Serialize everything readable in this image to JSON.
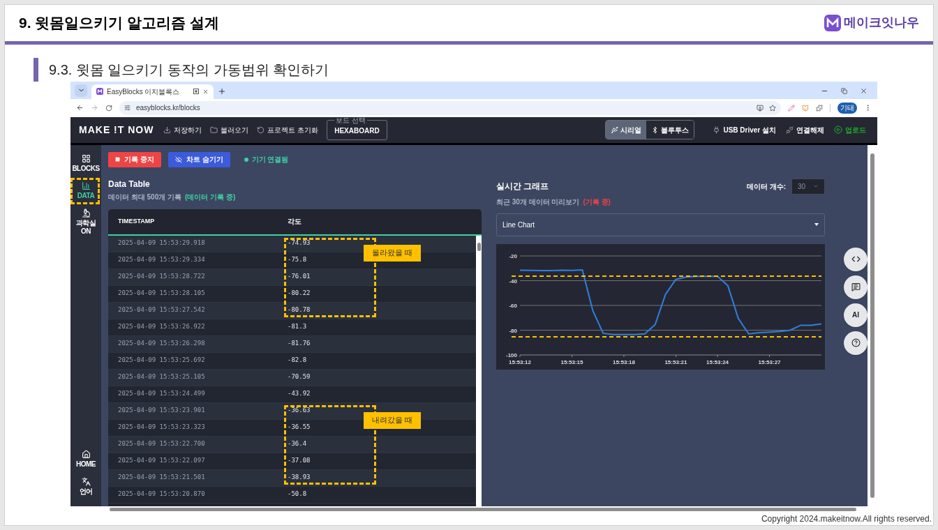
{
  "slide": {
    "title": "9. 윗몸일으키기 알고리즘 설계",
    "logo": "메이크잇나우",
    "section_title": "9.3. 윗몸 일으키기 동작의 가동범위 확인하기",
    "copyright": "Copyright 2024.makeitnow.All rights reserved."
  },
  "browser": {
    "tabs": [
      {
        "title": "EasyBlocks 이지블록스",
        "selected": true
      }
    ],
    "address": "easyblocks.kr/blocks",
    "profile": "기태"
  },
  "app": {
    "logo": "MAKE !T NOW",
    "toolbar": [
      {
        "label": "저장하기",
        "kind": "save"
      },
      {
        "label": "불러오기",
        "kind": "open"
      },
      {
        "label": "프로젝트 초기화",
        "kind": "reset"
      }
    ],
    "board_select": {
      "legend": "보드 선택",
      "value": "HEXABOARD"
    },
    "connection": [
      {
        "label": "시리얼",
        "kind": "serial",
        "selected": true
      },
      {
        "label": "블루투스",
        "kind": "bluetooth",
        "selected": false
      }
    ],
    "actions": [
      {
        "label": "USB Driver 설치",
        "kind": "driver"
      },
      {
        "label": "연결해제",
        "kind": "disconnect"
      },
      {
        "label": "업로드",
        "kind": "upload"
      }
    ]
  },
  "sidebar": {
    "items": [
      {
        "label": "BLOCKS",
        "kind": "blocks",
        "selected": false,
        "highlighted": false
      },
      {
        "label": "DATA",
        "kind": "data",
        "selected": true,
        "highlighted": true
      },
      {
        "label": "과학실 ON",
        "kind": "lab",
        "selected": false,
        "highlighted": false
      }
    ],
    "bottom_items": [
      {
        "label": "HOME",
        "kind": "home"
      },
      {
        "label": "언어",
        "kind": "language"
      }
    ]
  },
  "controls": {
    "buttons": [
      {
        "label": "기록 중지",
        "kind": "stop"
      },
      {
        "label": "차트 숨기기",
        "kind": "hide_chart"
      }
    ],
    "status": "기기 연결됨"
  },
  "data_table": {
    "title": "Data Table",
    "subtitle": "데이터 최대 500개 기록",
    "recording_note": "(데이터 기록 중)",
    "columns": [
      "TIMESTAMP",
      "각도"
    ],
    "row_groups": [
      {
        "highlighted": true,
        "callout": "올라왔을 때",
        "rows": [
          [
            "2025-04-09 15:53:29.918",
            "-74.93"
          ],
          [
            "2025-04-09 15:53:29.334",
            "-75.8"
          ],
          [
            "2025-04-09 15:53:28.722",
            "-76.01"
          ],
          [
            "2025-04-09 15:53:28.105",
            "-80.22"
          ],
          [
            "2025-04-09 15:53:27.542",
            "-80.78"
          ]
        ]
      },
      {
        "highlighted": false,
        "rows": [
          [
            "2025-04-09 15:53:26.922",
            "-81.3"
          ],
          [
            "2025-04-09 15:53:26.298",
            "-81.76"
          ],
          [
            "2025-04-09 15:53:25.692",
            "-82.8"
          ],
          [
            "2025-04-09 15:53:25.105",
            "-70.59"
          ],
          [
            "2025-04-09 15:53:24.499",
            "-43.92"
          ]
        ]
      },
      {
        "highlighted": true,
        "callout": "내려갔을 때",
        "rows": [
          [
            "2025-04-09 15:53:23.901",
            "-36.63"
          ],
          [
            "2025-04-09 15:53:23.323",
            "-36.55"
          ],
          [
            "2025-04-09 15:53:22.700",
            "-36.4"
          ],
          [
            "2025-04-09 15:53:22.097",
            "-37.08"
          ],
          [
            "2025-04-09 15:53:21.501",
            "-38.93"
          ]
        ]
      },
      {
        "highlighted": false,
        "rows": [
          [
            "2025-04-09 15:53:20.870",
            "-50.8"
          ]
        ]
      }
    ]
  },
  "graph": {
    "title": "실시간 그래프",
    "subtitle": "최근 30개 데이터 미리보기",
    "recording_note": "(기록 중)",
    "count_label": "데이터 개수:",
    "count_value": "30",
    "chart_type": "Line Chart",
    "chart_data": {
      "type": "line",
      "categories": [
        "15:53:12",
        null,
        null,
        null,
        null,
        "15:53:15",
        null,
        null,
        null,
        null,
        "15:53:18",
        null,
        null,
        null,
        null,
        "15:53:21",
        null,
        null,
        null,
        "15:53:24",
        null,
        null,
        null,
        null,
        "15:53:27",
        null,
        null,
        null,
        null,
        null
      ],
      "series": [
        {
          "color": "#2f7fe0",
          "values": [
            -31.5,
            -31.7,
            -31.8,
            -31.9,
            -31.6,
            -31.7,
            -31.3,
            -64,
            -82.5,
            -83.5,
            -83.5,
            -83.5,
            -83,
            -75.5,
            -51,
            -39,
            -37,
            -36.5,
            -36.5,
            -36.5,
            -44,
            -70.5,
            -83,
            -82,
            -81.5,
            -81,
            -80,
            -76,
            -76,
            -75
          ]
        }
      ],
      "ylim": [
        -100,
        -20
      ],
      "yticks": [
        -20,
        -40,
        -60,
        -80,
        -100
      ],
      "grid": true
    },
    "range_marked": true
  },
  "floating_buttons": [
    {
      "kind": "code"
    },
    {
      "kind": "chat"
    },
    {
      "kind": "ai",
      "label": "AI"
    },
    {
      "kind": "help"
    }
  ]
}
